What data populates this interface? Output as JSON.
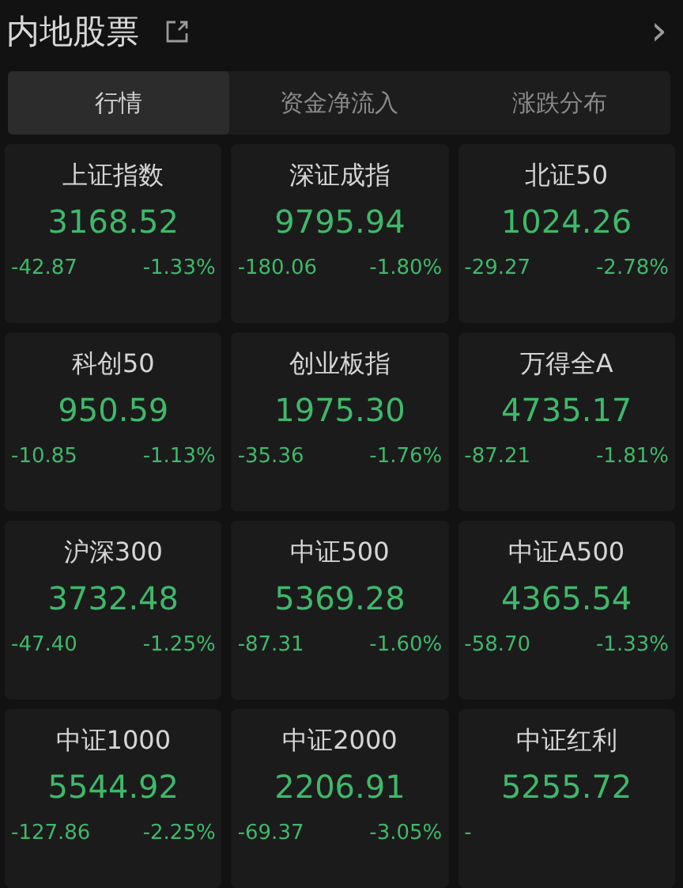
{
  "header": {
    "title": "内地股票",
    "chevron": "›"
  },
  "tabs": [
    {
      "label": "行情",
      "selected": true
    },
    {
      "label": "资金净流入",
      "selected": false
    },
    {
      "label": "涨跌分布",
      "selected": false
    }
  ],
  "indices": [
    {
      "name": "上证指数",
      "value": "3168.52",
      "change": "-42.87",
      "pct": "-1.33%"
    },
    {
      "name": "深证成指",
      "value": "9795.94",
      "change": "-180.06",
      "pct": "-1.80%"
    },
    {
      "name": "北证50",
      "value": "1024.26",
      "change": "-29.27",
      "pct": "-2.78%"
    },
    {
      "name": "科创50",
      "value": "950.59",
      "change": "-10.85",
      "pct": "-1.13%"
    },
    {
      "name": "创业板指",
      "value": "1975.30",
      "change": "-35.36",
      "pct": "-1.76%"
    },
    {
      "name": "万得全A",
      "value": "4735.17",
      "change": "-87.21",
      "pct": "-1.81%"
    },
    {
      "name": "沪深300",
      "value": "3732.48",
      "change": "-47.40",
      "pct": "-1.25%"
    },
    {
      "name": "中证500",
      "value": "5369.28",
      "change": "-87.31",
      "pct": "-1.60%"
    },
    {
      "name": "中证A500",
      "value": "4365.54",
      "change": "-58.70",
      "pct": "-1.33%"
    },
    {
      "name": "中证1000",
      "value": "5544.92",
      "change": "-127.86",
      "pct": "-2.25%"
    },
    {
      "name": "中证2000",
      "value": "2206.91",
      "change": "-69.37",
      "pct": "-3.05%"
    },
    {
      "name": "中证红利",
      "value": "5255.72",
      "change": "-"
    }
  ]
}
